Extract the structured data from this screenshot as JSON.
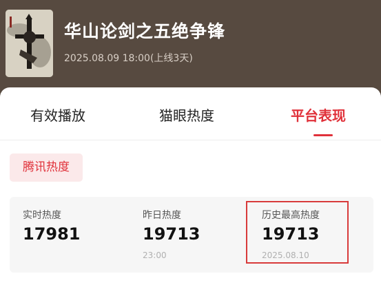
{
  "movie": {
    "title": "华山论剑之五绝争锋",
    "subtitle": "2025.08.09 18:00(上线3天)"
  },
  "tabs": [
    {
      "label": "有效播放",
      "active": false
    },
    {
      "label": "猫眼热度",
      "active": false
    },
    {
      "label": "平台表现",
      "active": true
    }
  ],
  "platform_chip": "腾讯热度",
  "stats": [
    {
      "label": "实时热度",
      "value": "17981",
      "note": ""
    },
    {
      "label": "昨日热度",
      "value": "19713",
      "note": "23:00"
    },
    {
      "label": "历史最高热度",
      "value": "19713",
      "note": "2025.08.10"
    }
  ],
  "colors": {
    "header_bg": "#574a40",
    "accent": "#e0313a",
    "highlight_border": "#d83a3a"
  }
}
